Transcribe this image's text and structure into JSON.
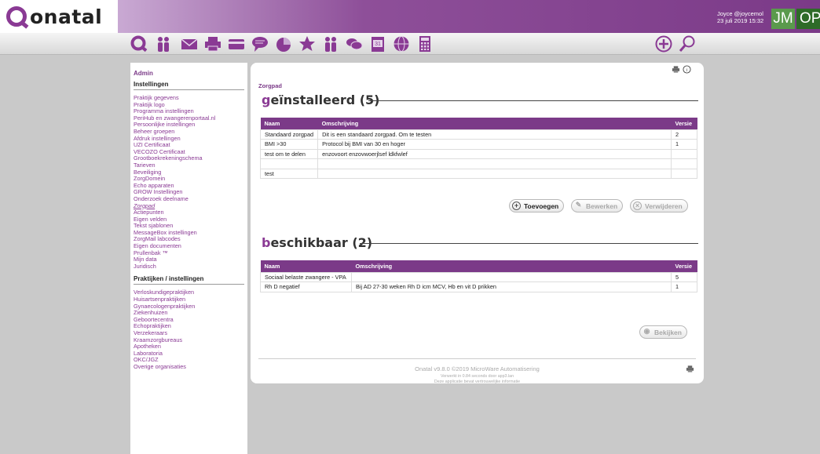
{
  "app": {
    "logo_text": "onatal",
    "user_name": "Joyce @joycemol",
    "datetime": "23 juli 2019 15:32",
    "avatar_initials": "JM",
    "avatar2_text": "OP"
  },
  "sidebar": {
    "admin_label": "Admin",
    "section1_title": "Instellingen",
    "section1_items": [
      "Praktijk gegevens",
      "Praktijk logo",
      "Programma instellingen",
      "PeriHub en zwangerenportaal.nl",
      "Persoonlijke instellingen",
      "Beheer groepen",
      "Afdruk instellingen",
      "UZI Certificaat",
      "VECOZO Certificaat",
      "Grootboekrekeningschema",
      "Tarieven",
      "Beveiliging",
      "ZorgDomein",
      "Echo apparaten",
      "GROW Instellingen",
      "Onderzoek deelname",
      "Zorgpad",
      "Actiepunten",
      "Eigen velden",
      "Tekst sjablonen",
      "MessageBox instellingen",
      "ZorgMail labcodes",
      "Eigen documenten",
      "Prullenbak ™",
      "Mijn data",
      "Juridisch"
    ],
    "active_item": "Zorgpad",
    "section2_title": "Praktijken / instellingen",
    "section2_items": [
      "Verloskundigepraktijken",
      "Huisartsenpraktijken",
      "Gynaecologenpraktijken",
      "Ziekenhuizen",
      "Geboortecentra",
      "Echopraktijken",
      "Verzekeraars",
      "Kraamzorgbureaus",
      "Apotheken",
      "Laboratoria",
      "OKC/JGZ",
      "Overige organisaties"
    ]
  },
  "main": {
    "breadcrumb": "Zorgpad",
    "installed": {
      "title_first": "g",
      "title_rest": "eïnstalleerd (5)",
      "headers": [
        "Naam",
        "Omschrijving",
        "Versie"
      ],
      "rows": [
        [
          "Standaard zorgpad",
          "Dit is een standaard zorgpad. Om te testen",
          "2"
        ],
        [
          "BMI >30",
          "Protocol bij BMI van 30 en hoger",
          "1"
        ],
        [
          "test om te delen",
          "enzovoort enzovwoerjlsef ldkfwlef",
          ""
        ],
        [
          "",
          "",
          ""
        ],
        [
          "test",
          "",
          ""
        ]
      ],
      "btn_add": "Toevoegen",
      "btn_edit": "Bewerken",
      "btn_delete": "Verwijderen"
    },
    "available": {
      "title_first": "b",
      "title_rest": "eschikbaar (2)",
      "headers": [
        "Naam",
        "Omschrijving",
        "Versie"
      ],
      "rows": [
        [
          "Sociaal belaste zwangere - VPA",
          "",
          "5"
        ],
        [
          "Rh D negatief",
          "Bij AD 27-30 weken Rh D icm MCV, Hb en vit D prikken",
          "1"
        ]
      ],
      "btn_view": "Bekijken"
    },
    "footer": {
      "line1": "Onatal v9.8.0 ©2019 MicroWare Automatisering",
      "line2": "Verwerkt in 0.84 seconds door app3.lan",
      "line3": "Deze applicatie bevat vertrouwelijke informatie"
    }
  },
  "colors": {
    "brand": "#7b3a88",
    "accent": "#8a3a94"
  }
}
